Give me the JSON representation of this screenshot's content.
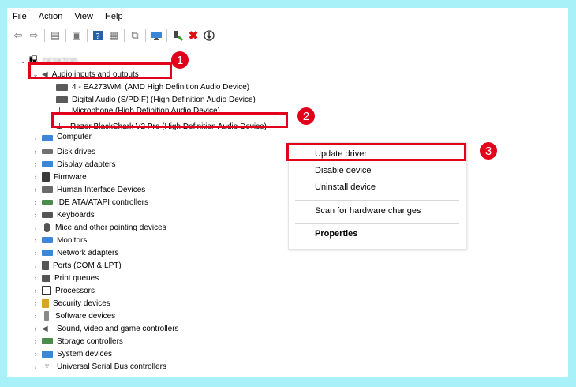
{
  "menu": [
    "File",
    "Action",
    "View",
    "Help"
  ],
  "toolbar_icons": [
    "back-arrow-icon",
    "forward-arrow-icon",
    "properties-icon",
    "view-icon",
    "help-icon",
    "grid-icon",
    "scan-icon",
    "monitor-icon",
    "enable-device-icon",
    "uninstall-icon",
    "download-icon"
  ],
  "tree": {
    "computer_name": "DESKTOP-",
    "audio_category": "Audio inputs and outputs",
    "audio_devices": [
      "4 - EA273WMi (AMD High Definition Audio Device)",
      "Digital Audio (S/PDIF) (High Definition Audio Device)",
      "Microphone (High Definition Audio Device)",
      "Razer BlackShark V2 Pro (High Definition Audio Device)"
    ],
    "categories": [
      "Computer",
      "Disk drives",
      "Display adapters",
      "Firmware",
      "Human Interface Devices",
      "IDE ATA/ATAPI controllers",
      "Keyboards",
      "Mice and other pointing devices",
      "Monitors",
      "Network adapters",
      "Ports (COM & LPT)",
      "Print queues",
      "Processors",
      "Security devices",
      "Software devices",
      "Sound, video and game controllers",
      "Storage controllers",
      "System devices",
      "Universal Serial Bus controllers"
    ]
  },
  "context_menu": {
    "update": "Update driver",
    "disable": "Disable device",
    "uninstall": "Uninstall device",
    "scan": "Scan for hardware changes",
    "properties": "Properties"
  },
  "callouts": [
    "1",
    "2",
    "3"
  ],
  "colors": {
    "callout_red": "#e3001b",
    "background": "#a8f1f9"
  }
}
